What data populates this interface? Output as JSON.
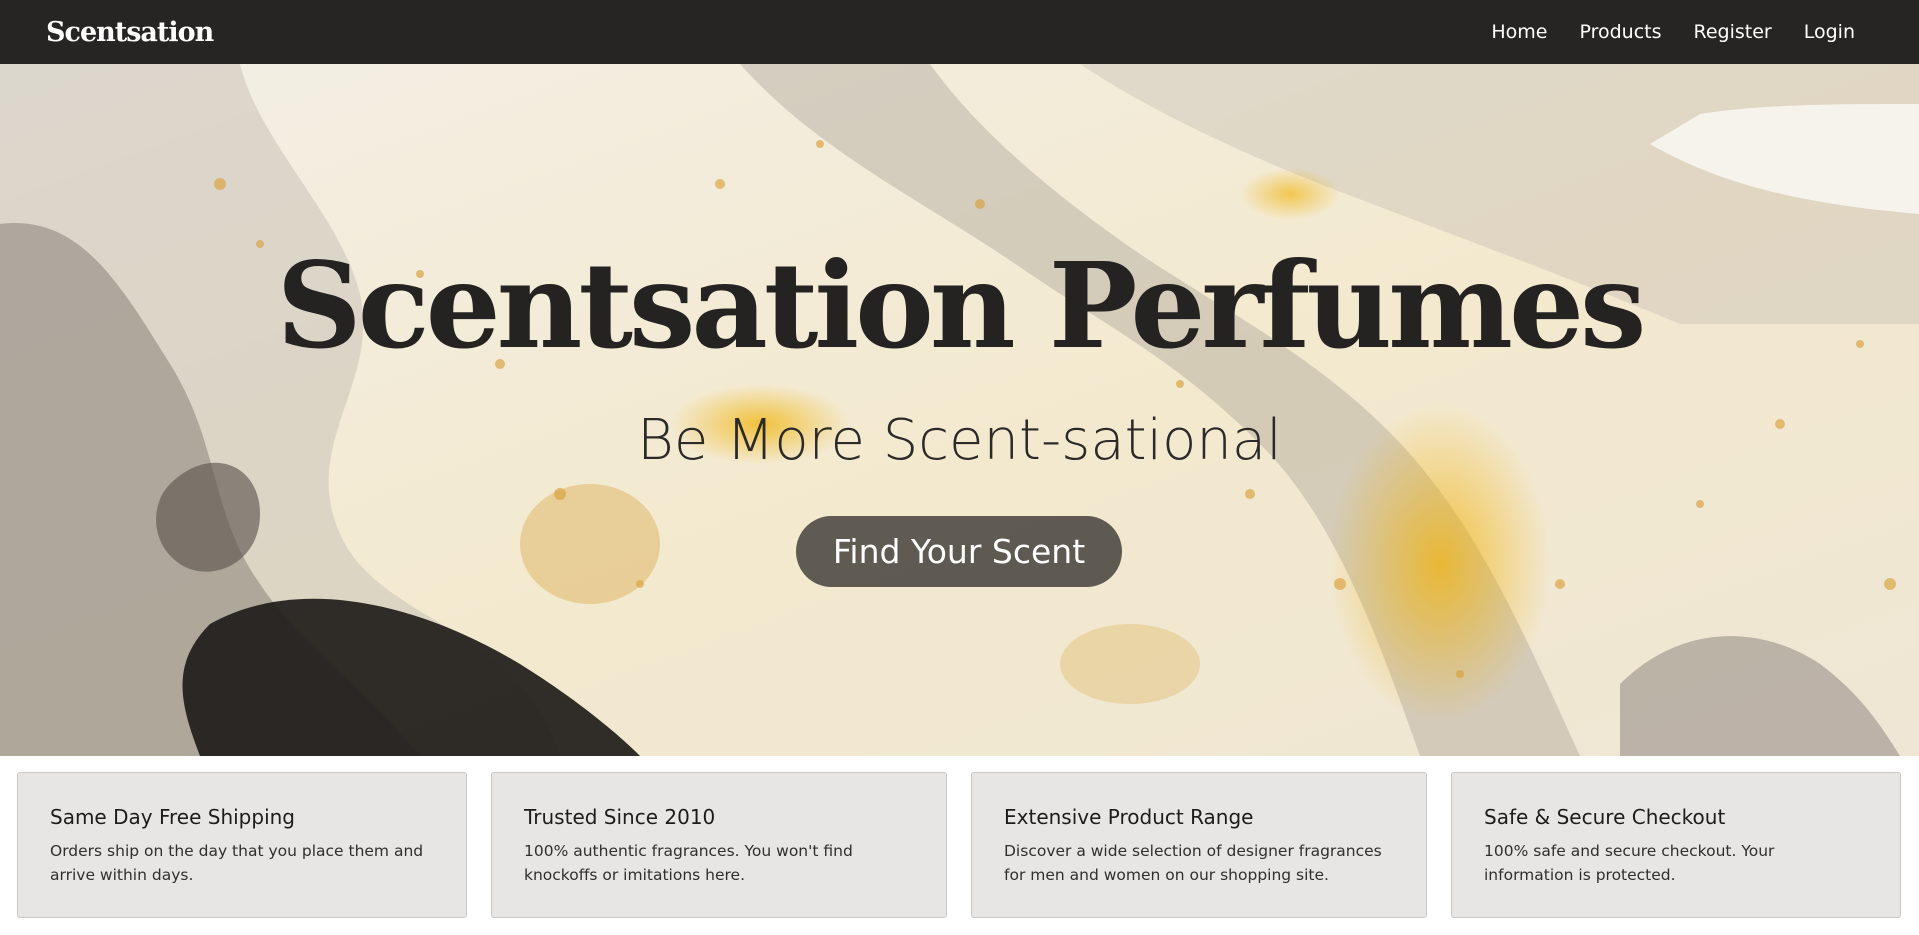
{
  "nav": {
    "brand": "Scentsation",
    "links": [
      "Home",
      "Products",
      "Register",
      "Login"
    ]
  },
  "hero": {
    "title": "Scentsation Perfumes",
    "subtitle": "Be More Scent-sational",
    "cta_label": "Find Your Scent"
  },
  "features": [
    {
      "title": "Same Day Free Shipping",
      "text": "Orders ship on the day that you place them and arrive within days."
    },
    {
      "title": "Trusted Since 2010",
      "text": "100% authentic fragrances. You won't find knockoffs or imitations here."
    },
    {
      "title": "Extensive Product Range",
      "text": "Discover a wide selection of designer fragrances for men and women on our shopping site."
    },
    {
      "title": "Safe & Secure Checkout",
      "text": "100% safe and secure checkout. Your information is protected."
    }
  ],
  "colors": {
    "navbar": "#262523",
    "hero_base": "#ece4d2",
    "gold": "#e7a72a",
    "card_bg": "#e8e6e4"
  }
}
